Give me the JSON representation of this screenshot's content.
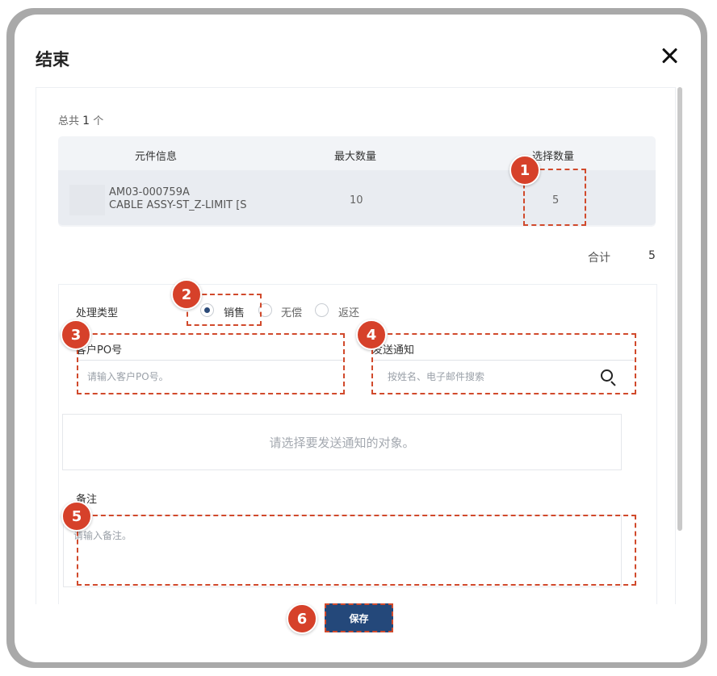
{
  "dialog": {
    "title": "结束",
    "close_icon": "close-icon"
  },
  "summary": {
    "total_prefix": "总共",
    "total_count": "1",
    "total_suffix": "个"
  },
  "table": {
    "headers": [
      "元件信息",
      "最大数量",
      "选择数量"
    ],
    "rows": [
      {
        "part_number": "AM03-000759A",
        "part_desc": "CABLE ASSY-ST_Z-LIMIT [S",
        "max_qty": "10",
        "selected_qty": "5"
      }
    ]
  },
  "subtotal": {
    "label": "合计",
    "value": "5"
  },
  "form": {
    "process_type_label": "处理类型",
    "process_options": [
      {
        "label": "销售",
        "selected": true
      },
      {
        "label": "无偿",
        "selected": false
      },
      {
        "label": "返还",
        "selected": false
      }
    ],
    "customer_po": {
      "label": "客户PO号",
      "placeholder": "请输入客户PO号。"
    },
    "notify": {
      "label": "发送通知",
      "placeholder": "按姓名、电子邮件搜索",
      "empty_text": "请选择要发送通知的对象。"
    },
    "remark": {
      "label": "备注",
      "placeholder": "请输入备注。"
    }
  },
  "footer": {
    "save_label": "保存"
  },
  "callouts": [
    "1",
    "2",
    "3",
    "4",
    "5",
    "6"
  ],
  "colors": {
    "primary": "#24487a",
    "callout": "#d6412a"
  }
}
